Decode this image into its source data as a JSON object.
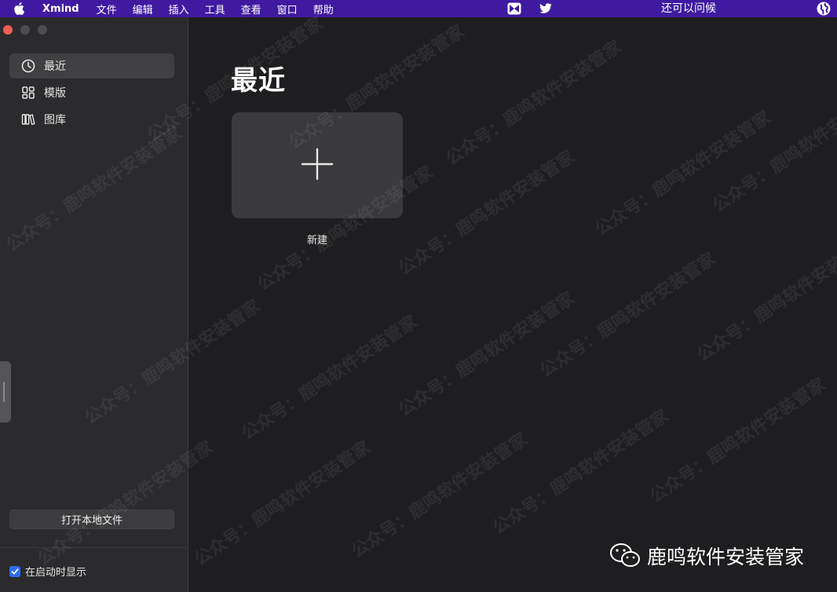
{
  "menubar": {
    "app_name": "Xmind",
    "menus": [
      "文件",
      "编辑",
      "插入",
      "工具",
      "查看",
      "窗口",
      "帮助"
    ],
    "status_text": "还可以问候"
  },
  "sidebar": {
    "items": [
      {
        "label": "最近",
        "icon": "clock-icon",
        "active": true
      },
      {
        "label": "模版",
        "icon": "grid-icon",
        "active": false
      },
      {
        "label": "图库",
        "icon": "library-icon",
        "active": false
      }
    ],
    "open_local": "打开本地文件",
    "show_on_startup": "在启动时显示",
    "show_on_startup_checked": true
  },
  "main": {
    "title": "最近",
    "new_label": "新建"
  },
  "watermark": {
    "text": "公众号：鹿鸣软件安装管家",
    "brand": "鹿鸣软件安装管家"
  },
  "colors": {
    "menubar_bg": "#3f1aa0",
    "sidebar_bg": "#2b2b2d",
    "main_bg": "#1e1e20",
    "accent": "#2c6ef2",
    "close_button": "#ec5f57"
  }
}
